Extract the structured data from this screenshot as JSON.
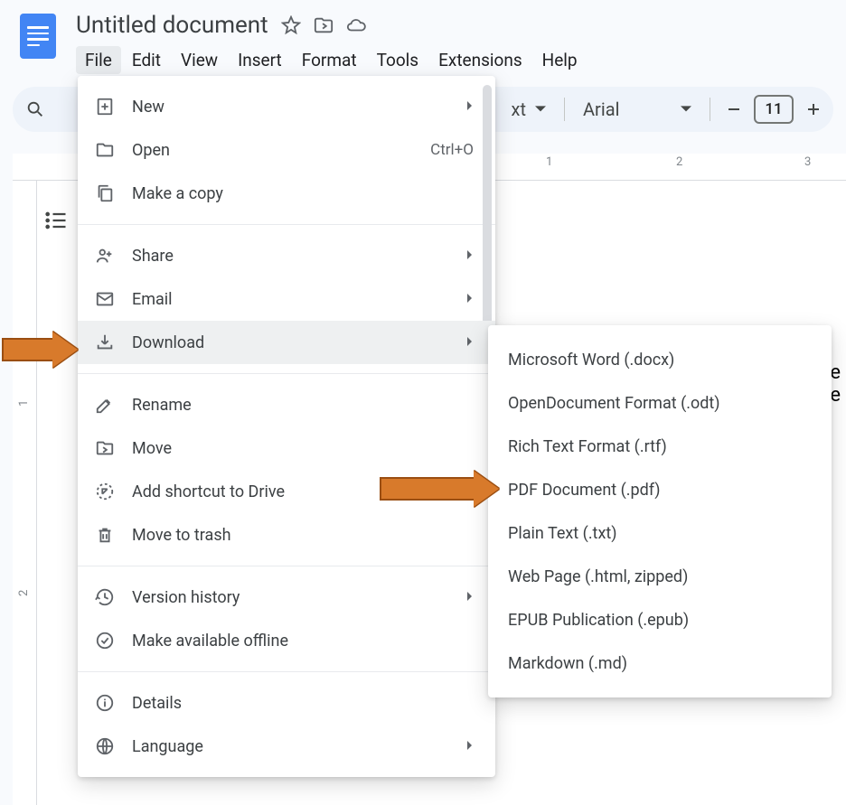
{
  "header": {
    "title": "Untitled document"
  },
  "menubar": [
    "File",
    "Edit",
    "View",
    "Insert",
    "Format",
    "Tools",
    "Extensions",
    "Help"
  ],
  "active_menu_index": 0,
  "toolbar": {
    "text_style_label": "xt",
    "font_label": "Arial",
    "font_size": "11"
  },
  "ruler": {
    "labels": [
      "1",
      "2",
      "3"
    ],
    "vlabels": [
      "1",
      "2"
    ]
  },
  "file_menu": {
    "groups": [
      [
        {
          "icon": "new",
          "label": "New",
          "has_sub": true
        },
        {
          "icon": "open",
          "label": "Open",
          "shortcut": "Ctrl+O"
        },
        {
          "icon": "copy",
          "label": "Make a copy"
        }
      ],
      [
        {
          "icon": "share",
          "label": "Share",
          "has_sub": true
        },
        {
          "icon": "email",
          "label": "Email",
          "has_sub": true
        },
        {
          "icon": "download",
          "label": "Download",
          "has_sub": true,
          "hover": true
        }
      ],
      [
        {
          "icon": "rename",
          "label": "Rename"
        },
        {
          "icon": "move",
          "label": "Move"
        },
        {
          "icon": "shortcut",
          "label": "Add shortcut to Drive"
        },
        {
          "icon": "trash",
          "label": "Move to trash"
        }
      ],
      [
        {
          "icon": "history",
          "label": "Version history",
          "has_sub": true
        },
        {
          "icon": "offline",
          "label": "Make available offline"
        }
      ],
      [
        {
          "icon": "details",
          "label": "Details"
        },
        {
          "icon": "language",
          "label": "Language",
          "has_sub": true
        }
      ]
    ]
  },
  "download_submenu": [
    "Microsoft Word (.docx)",
    "OpenDocument Format (.odt)",
    "Rich Text Format (.rtf)",
    "PDF Document (.pdf)",
    "Plain Text (.txt)",
    "Web Page (.html, zipped)",
    "EPUB Publication (.epub)",
    "Markdown (.md)"
  ]
}
